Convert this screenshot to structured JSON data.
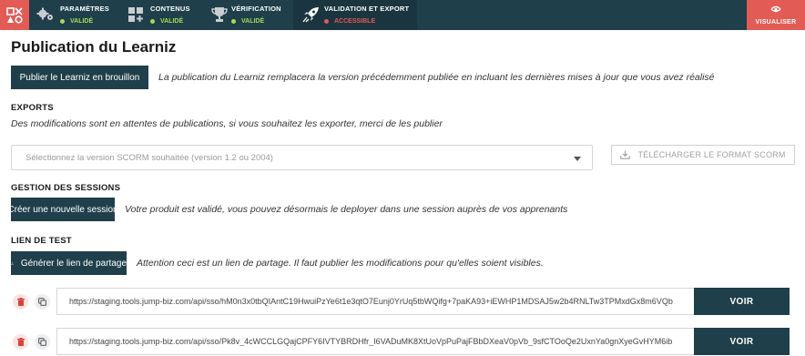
{
  "colors": {
    "accent": "#e25b55",
    "dark": "#1f3f4a",
    "valid": "#a8d957"
  },
  "topbar": {
    "steps": [
      {
        "label": "PARAMÈTRES",
        "status": "VALIDÉ",
        "icon": "gears-icon"
      },
      {
        "label": "CONTENUS",
        "status": "VALIDÉ",
        "icon": "content-blocks-icon"
      },
      {
        "label": "VÉRIFICATION",
        "status": "VALIDÉ",
        "icon": "trophy-icon"
      },
      {
        "label": "VALIDATION ET EXPORT",
        "status": "ACCESSIBLE",
        "icon": "rocket-icon"
      }
    ],
    "visualiser_label": "VISUALISER"
  },
  "page": {
    "title": "Publication du Learniz",
    "publish_button": "Publier le Learniz en brouillon",
    "publish_note": "La publication du Learniz remplacera la version précédemment publiée en incluant les dernières mises à jour que vous avez réalisé"
  },
  "exports": {
    "heading": "EXPORTS",
    "note": "Des modifications sont en attentes de publications, si vous souhaitez les exporter, merci de les publier",
    "select_placeholder": "Sélectionnez la version SCORM souhaitée (version 1.2 ou 2004)",
    "download_button": "TÉLÉCHARGER LE FORMAT SCORM"
  },
  "sessions": {
    "heading": "GESTION DES SESSIONS",
    "create_button": "Créer une nouvelle session",
    "note": "Votre produit est validé, vous pouvez désormais le deployer dans une session auprès de vos apprenants"
  },
  "test_link": {
    "heading": "LIEN DE TEST",
    "generate_button": "Générer le lien de partage",
    "note": "Attention ceci est un lien de partage. Il faut publier les modifications pour qu'elles soient visibles.",
    "links": [
      {
        "url": "https://staging.tools.jump-biz.com/api/sso/hM0n3x0tbQIAntC19HwuiPzYe6t1e3qtO7Eunj0YrUq5tbWQifg+7paKA93+iEWHP1MDSAJ5w2b4RNLTw3TPMxdGx8m6VQb",
        "view_label": "VOIR"
      },
      {
        "url": "https://staging.tools.jump-biz.com/api/sso/Pk8v_4cWCCLGQajCPFY6IVTYBRDHfr_I6VADuMK8XtUoVpPuPajFBbDXeaV0pVb_9sfCTOoQe2UxnYa0gnXyeGvHYM6ib",
        "view_label": "VOIR"
      }
    ]
  }
}
